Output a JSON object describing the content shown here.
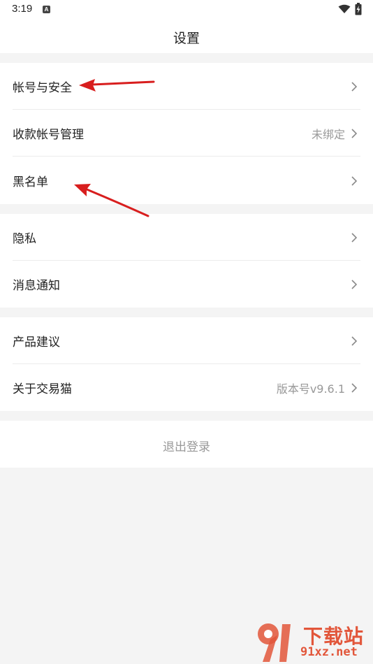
{
  "status_bar": {
    "time": "3:19",
    "app_icon": "A"
  },
  "header": {
    "title": "设置"
  },
  "groups": [
    {
      "items": [
        {
          "label": "帐号与安全",
          "value": ""
        },
        {
          "label": "收款帐号管理",
          "value": "未绑定"
        },
        {
          "label": "黑名单",
          "value": ""
        }
      ]
    },
    {
      "items": [
        {
          "label": "隐私",
          "value": ""
        },
        {
          "label": "消息通知",
          "value": ""
        }
      ]
    },
    {
      "items": [
        {
          "label": "产品建议",
          "value": ""
        },
        {
          "label": "关于交易猫",
          "value": "版本号v9.6.1"
        }
      ]
    }
  ],
  "logout": {
    "label": "退出登录"
  },
  "watermark": {
    "brand": "下载站",
    "domain": "91xz.net"
  },
  "colors": {
    "accent": "#e2563a",
    "annotation": "#d81e1e",
    "background": "#f4f4f4",
    "muted_text": "#999999"
  }
}
